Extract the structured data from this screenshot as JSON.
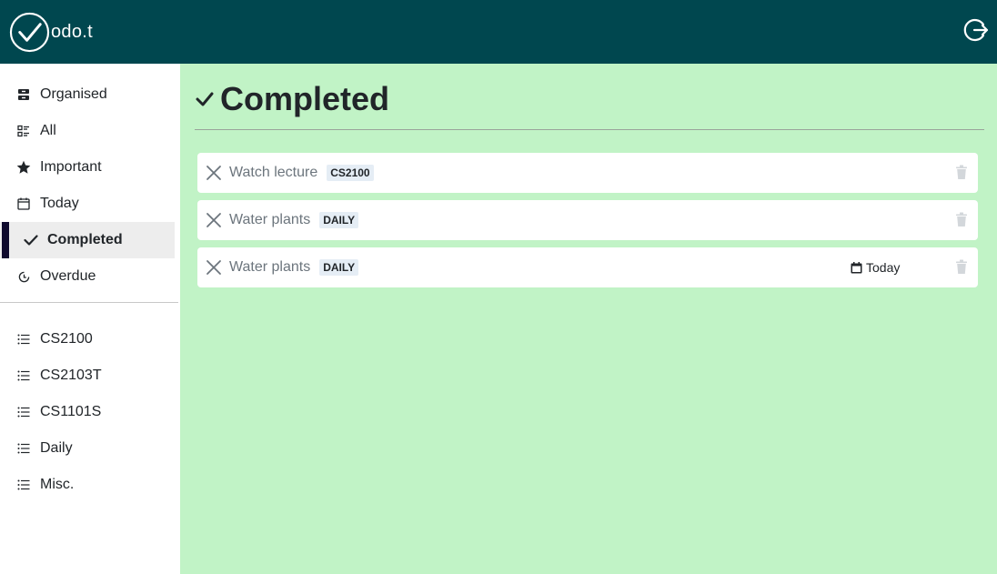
{
  "app": {
    "logo_text": "odo.t"
  },
  "sidebar": {
    "items": [
      {
        "label": "Organised",
        "icon": "archive-icon"
      },
      {
        "label": "All",
        "icon": "list-details-icon"
      },
      {
        "label": "Important",
        "icon": "star-icon"
      },
      {
        "label": "Today",
        "icon": "calendar-icon"
      },
      {
        "label": "Completed",
        "icon": "check-icon",
        "active": true
      },
      {
        "label": "Overdue",
        "icon": "clock-icon"
      }
    ],
    "projects": [
      {
        "label": "CS2100",
        "icon": "list-icon"
      },
      {
        "label": "CS2103T",
        "icon": "list-icon"
      },
      {
        "label": "CS1101S",
        "icon": "list-icon"
      },
      {
        "label": "Daily",
        "icon": "list-icon"
      },
      {
        "label": "Misc.",
        "icon": "list-icon"
      }
    ]
  },
  "main": {
    "title": "Completed",
    "tasks": [
      {
        "name": "Watch lecture",
        "tag": "CS2100",
        "due": null
      },
      {
        "name": "Water plants",
        "tag": "DAILY",
        "due": null
      },
      {
        "name": "Water plants",
        "tag": "DAILY",
        "due": "Today"
      }
    ]
  },
  "colors": {
    "topbar": "#00474f",
    "main_bg": "#c1f3c6",
    "active_indicator": "#0f0a2e"
  }
}
